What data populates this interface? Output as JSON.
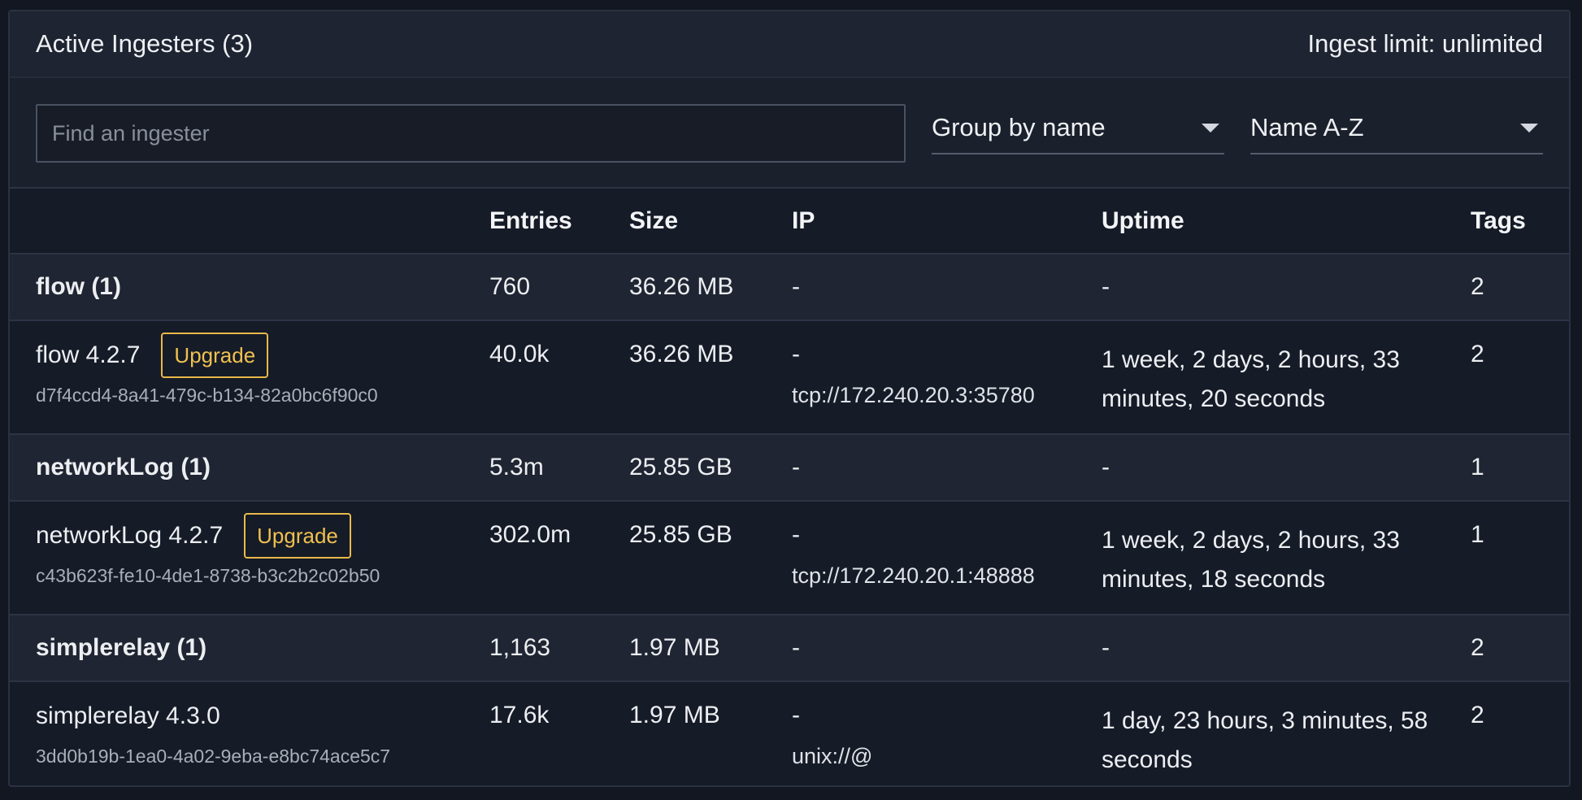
{
  "header": {
    "title": "Active Ingesters (3)",
    "limit": "Ingest limit: unlimited"
  },
  "toolbar": {
    "search_placeholder": "Find an ingester",
    "group_by": "Group by name",
    "sort_by": "Name A-Z"
  },
  "table": {
    "headers": [
      "",
      "Entries",
      "Size",
      "IP",
      "Uptime",
      "Tags"
    ],
    "groups": [
      {
        "name": "flow (1)",
        "entries": "760",
        "size": "36.26 MB",
        "ip": "-",
        "uptime": "-",
        "tags": "2",
        "item": {
          "name": "flow 4.2.7",
          "action": "Upgrade",
          "uuid": "d7f4ccd4-8a41-479c-b134-82a0bc6f90c0",
          "entries": "40.0k",
          "size": "36.26 MB",
          "ip": "-",
          "address": "tcp://172.240.20.3:35780",
          "uptime": "1 week, 2 days, 2 hours, 33 minutes, 20 seconds",
          "tags": "2"
        }
      },
      {
        "name": "networkLog (1)",
        "entries": "5.3m",
        "size": "25.85 GB",
        "ip": "-",
        "uptime": "-",
        "tags": "1",
        "item": {
          "name": "networkLog 4.2.7",
          "action": "Upgrade",
          "uuid": "c43b623f-fe10-4de1-8738-b3c2b2c02b50",
          "entries": "302.0m",
          "size": "25.85 GB",
          "ip": "-",
          "address": "tcp://172.240.20.1:48888",
          "uptime": "1 week, 2 days, 2 hours, 33 minutes, 18 seconds",
          "tags": "1"
        }
      },
      {
        "name": "simplerelay (1)",
        "entries": "1,163",
        "size": "1.97 MB",
        "ip": "-",
        "uptime": "-",
        "tags": "2",
        "item": {
          "name": "simplerelay 4.3.0",
          "uuid": "3dd0b19b-1ea0-4a02-9eba-e8bc74ace5c7",
          "entries": "17.6k",
          "size": "1.97 MB",
          "ip": "-",
          "address": "unix://@",
          "uptime": "1 day, 23 hours, 3 minutes, 58 seconds",
          "tags": "2"
        }
      }
    ]
  }
}
